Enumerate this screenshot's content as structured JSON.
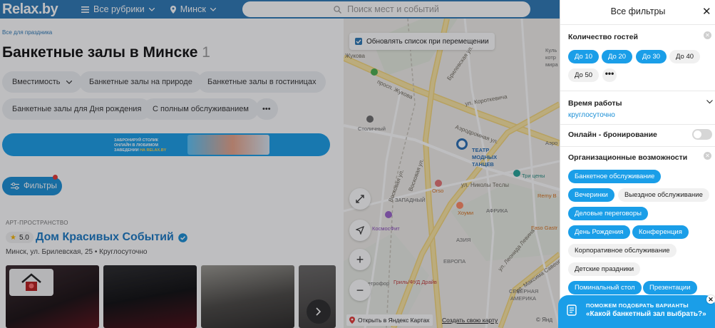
{
  "header": {
    "logo": "Relax.by",
    "categories": "Все рубрики",
    "city": "Минск",
    "search_placeholder": "Поиск мест и событий"
  },
  "breadcrumb": "Все для праздника",
  "page": {
    "title": "Банкетные залы в Минске",
    "count": "1"
  },
  "chips": [
    "Вместимость",
    "Банкетные залы на природе",
    "Банкетные залы в гостиницах",
    "Банкетные залы для Дня рождения",
    "С полным обслуживанием",
    "•••"
  ],
  "banner": {
    "line1": "Забронируй столик",
    "line2": "онлайн в любимом",
    "line3": "заведении",
    "line3_accent": "на Relax.by"
  },
  "filters_button": "Фильтры",
  "card": {
    "type": "Арт-пространство",
    "rating": "5.0",
    "name": "Дом Красивых Событий",
    "address": "Минск, ул. Брилевская, 25 • Круглосуточно"
  },
  "map": {
    "update_label": "Обновлять список при перемещении",
    "zoom_in": "+",
    "zoom_out": "−",
    "open_yandex": "Открыть в Яндекс Картах",
    "own_map": "Создать свою карту",
    "copyright": "© Янд",
    "labels": {
      "zhukova": "Жукова",
      "prosp_zhukova": "просп. Жукова",
      "brilevskaya": "Брилевская ул.",
      "korotkevicha": "ул. Короткевича",
      "aerodromnaya": "Аэродромная ул.",
      "stolichny": "Столичный",
      "teatr1": "ТЕАТР",
      "teatr2": "МОДНЫХ",
      "teatr3": "ТАНЦЕВ",
      "vosk1": "Восковая ул.",
      "vosk2": "Восковая ул.",
      "zapadny": "ЗАПАДНЫЙ",
      "orso": "Orso",
      "nikoly_tesly": "ул. Николы Теслы",
      "tri_seny": "Три цены",
      "remy": "Remy В",
      "khoumi": "Хоуми",
      "afrika": "АФРИКА",
      "faso": "Faso Gastr",
      "kosmosfit": "КосмосФит",
      "aziya": "АЗИЯ",
      "evropa": "ЕВРОПА",
      "vetrov": "ветрофор",
      "gril": "Гриль/ФУД Драйв",
      "severnaya1": "СЕВЕРНАЯ",
      "severnaya2": "АМЕРИКА",
      "lenina": "ул. Леонида Левина",
      "moinsava": "ул. Максима Савеорд",
      "aero": "Аэро",
      "ku": "Куль",
      "kotran": "котр",
      "mira": "мира"
    }
  },
  "panel": {
    "title": "Все фильтры",
    "close": "✕",
    "guests": {
      "title": "Количество гостей",
      "options": [
        {
          "label": "До 10",
          "on": true
        },
        {
          "label": "До 20",
          "on": true
        },
        {
          "label": "До 30",
          "on": true
        },
        {
          "label": "До 40",
          "on": false
        },
        {
          "label": "До 50",
          "on": false
        }
      ],
      "more": "•••"
    },
    "work_time": {
      "title": "Время работы",
      "value": "круглосуточно"
    },
    "online_booking": {
      "title": "Онлайн - бронирование",
      "enabled": false
    },
    "org": {
      "title": "Организационные возможности",
      "options": [
        {
          "label": "Банкетное обслуживание",
          "on": true
        },
        {
          "label": "Вечеринки",
          "on": true
        },
        {
          "label": "Выездное обслуживание",
          "on": false
        },
        {
          "label": "Деловые переговоры",
          "on": true
        },
        {
          "label": "День Рождения",
          "on": true
        },
        {
          "label": "Конференция",
          "on": true
        },
        {
          "label": "Корпоративное обслуживание",
          "on": false
        },
        {
          "label": "Детские праздники",
          "on": false
        },
        {
          "label": "Поминальный стол",
          "on": true
        },
        {
          "label": "Презентации",
          "on": true
        }
      ]
    }
  },
  "help": {
    "line1": "ПОМОЖЕМ ПОДОБРАТЬ ВАРИАНТЫ",
    "line2": "«Какой банкетный зал выбрать?»",
    "close": "✕"
  },
  "colors": {
    "header": "#2d79b6",
    "accent": "#1a9ee8",
    "chip_bg": "#eef0f3",
    "pill_off": "#f0f0f0"
  }
}
